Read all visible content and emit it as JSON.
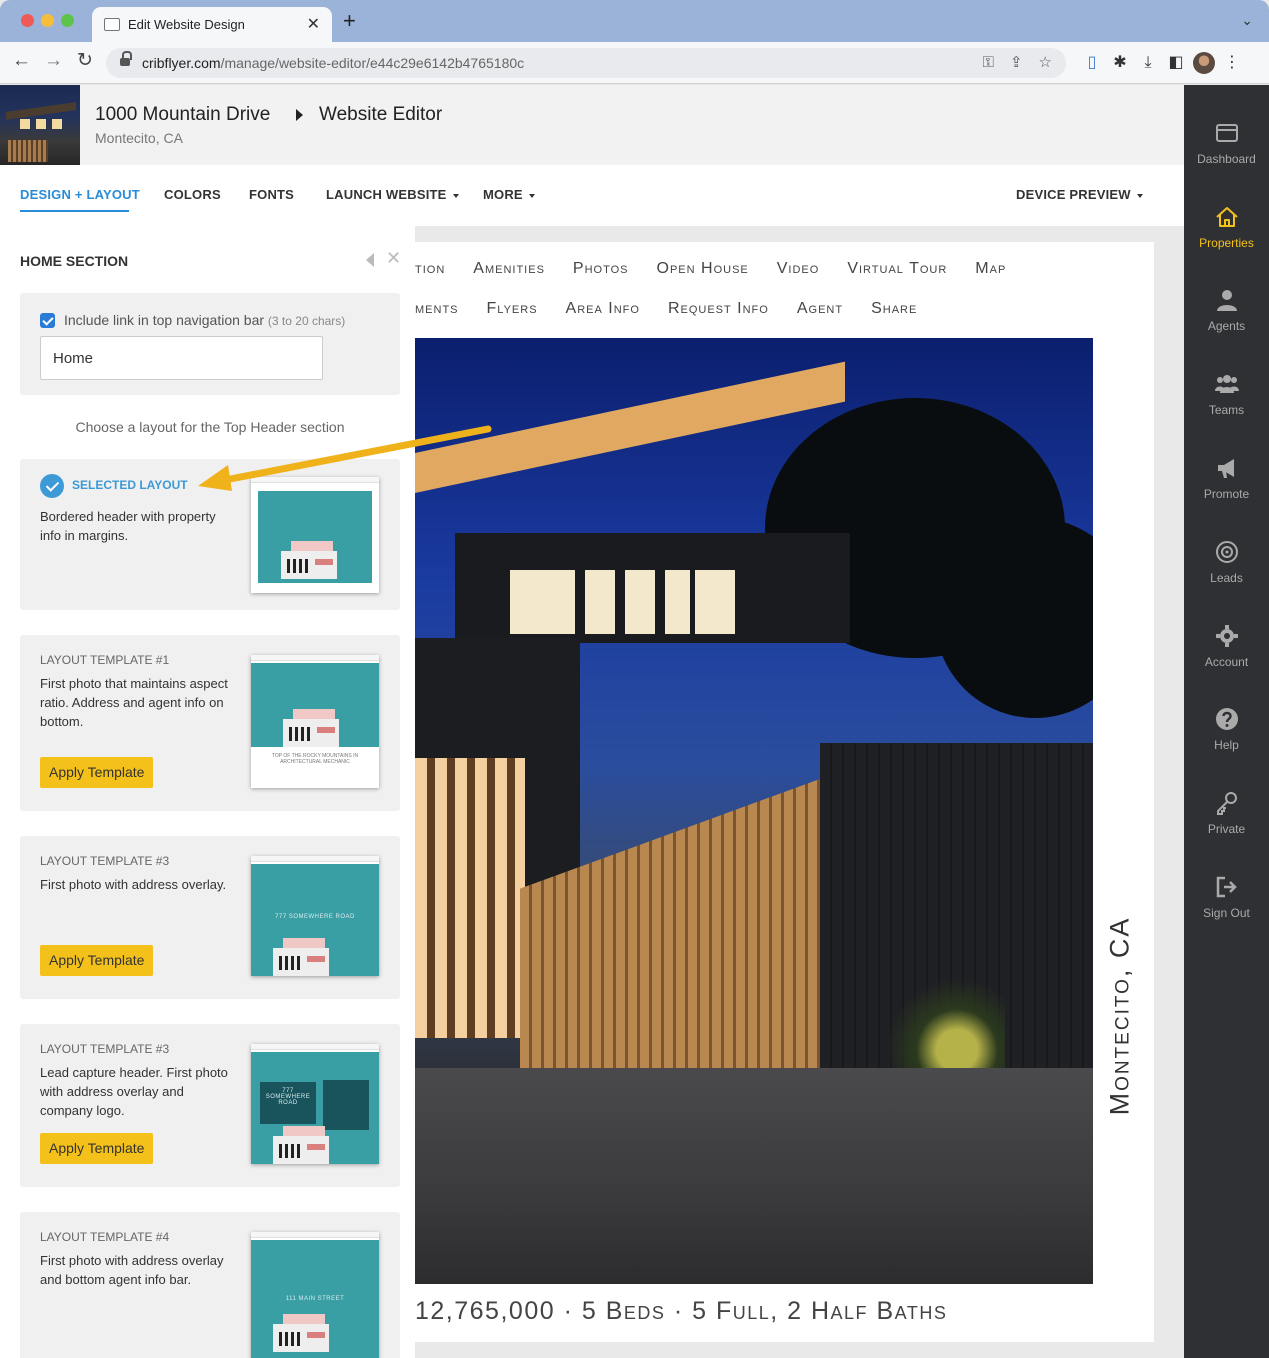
{
  "browser": {
    "tab_title": "Edit Website Design",
    "url_host": "cribflyer.com",
    "url_path": "/manage/website-editor/e44c29e6142b4765180c"
  },
  "header": {
    "property_title": "1000 Mountain Drive",
    "page_title": "Website Editor",
    "location": "Montecito, CA"
  },
  "menu": {
    "items": [
      "DESIGN + LAYOUT",
      "COLORS",
      "FONTS",
      "LAUNCH WEBSITE",
      "MORE"
    ],
    "device_preview": "DEVICE PREVIEW"
  },
  "panel": {
    "title": "HOME SECTION",
    "include_link_label": "Include link in top navigation bar",
    "include_link_hint": "(3 to 20 chars)",
    "nav_value": "Home",
    "choose_text": "Choose a layout for the Top Header section",
    "selected": {
      "label": "SELECTED LAYOUT",
      "desc": "Bordered header with property info in margins."
    },
    "templates": [
      {
        "title": "LAYOUT TEMPLATE #1",
        "desc": "First photo that maintains aspect ratio. Address and agent info on bottom.",
        "button": "Apply Template",
        "caption": "TOP OF THE ROCKY MOUNTAINS IN ARCHITECTURAL MECHANIC"
      },
      {
        "title": "LAYOUT TEMPLATE #3",
        "desc": "First photo with address overlay.",
        "button": "Apply Template",
        "overlay": "777 SOMEWHERE ROAD"
      },
      {
        "title": "LAYOUT TEMPLATE #3",
        "desc": "Lead capture header. First photo with address overlay and company logo.",
        "button": "Apply Template",
        "overlay": "777 SOMEWHERE ROAD"
      },
      {
        "title": "LAYOUT TEMPLATE #4",
        "desc": "First photo with address overlay and bottom agent info bar.",
        "button": "Apply Template",
        "overlay": "111 MAIN STREET"
      }
    ]
  },
  "preview": {
    "nav_row1": [
      "tion",
      "Amenities",
      "Photos",
      "Open House",
      "Video",
      "Virtual Tour",
      "Map"
    ],
    "nav_row2": [
      "ments",
      "Flyers",
      "Area Info",
      "Request Info",
      "Agent",
      "Share"
    ],
    "vertical_text": "Montecito, CA",
    "price_line": "12,765,000 · 5 Beds · 5 Full, 2 Half Baths"
  },
  "sidebar": {
    "items": [
      {
        "label": "Dashboard",
        "icon": "dashboard-icon"
      },
      {
        "label": "Properties",
        "icon": "home-icon"
      },
      {
        "label": "Agents",
        "icon": "user-icon"
      },
      {
        "label": "Teams",
        "icon": "users-icon"
      },
      {
        "label": "Promote",
        "icon": "megaphone-icon"
      },
      {
        "label": "Leads",
        "icon": "target-icon"
      },
      {
        "label": "Account",
        "icon": "gear-icon"
      },
      {
        "label": "Help",
        "icon": "question-icon"
      },
      {
        "label": "Private",
        "icon": "key-icon"
      },
      {
        "label": "Sign Out",
        "icon": "sign-out-icon"
      }
    ]
  },
  "colors": {
    "accent_blue": "#2a8bd6",
    "apply_yellow": "#f4c11b",
    "sidebar_bg": "#2f3033"
  }
}
